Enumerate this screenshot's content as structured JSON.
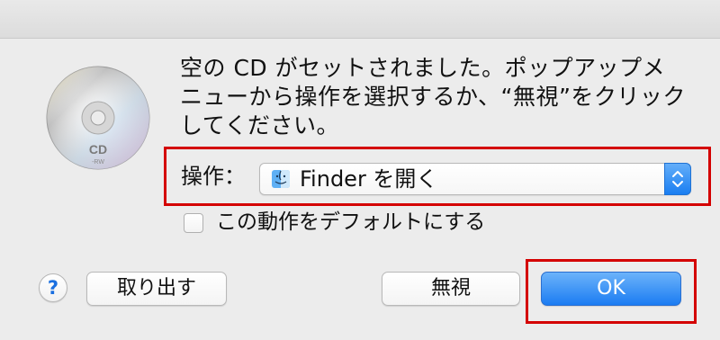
{
  "dialog": {
    "message": "空の CD がセットされました。ポップアップメ\nニューから操作を選択するか、“無視”をクリック\nしてください。",
    "cd_icon_text": "CD",
    "cd_icon_subtext": "-RW"
  },
  "action": {
    "label": "操作：",
    "selected_value": "Finder を開く",
    "finder_icon": "finder-icon",
    "stepper_icon": "up-down-chevron-icon"
  },
  "default_checkbox": {
    "label": "この動作をデフォルトにする",
    "checked": false
  },
  "buttons": {
    "help_label": "?",
    "eject_label": "取り出す",
    "ignore_label": "無視",
    "ok_label": "OK"
  },
  "colors": {
    "highlight": "#d40000",
    "primary_button": "#1b7cf2"
  }
}
